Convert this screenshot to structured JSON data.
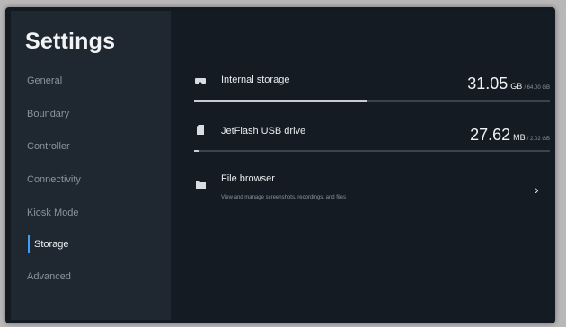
{
  "sidebar": {
    "title": "Settings",
    "items": [
      {
        "label": "General"
      },
      {
        "label": "Boundary"
      },
      {
        "label": "Controller"
      },
      {
        "label": "Connectivity"
      },
      {
        "label": "Kiosk Mode"
      },
      {
        "label": "Storage"
      },
      {
        "label": "Advanced"
      }
    ],
    "active_item": "Storage"
  },
  "storage": {
    "internal": {
      "label": "Internal storage",
      "used_value": "31.05",
      "used_unit": "GB",
      "total": "/ 64.00 GB",
      "used_fraction": 0.485
    },
    "usb": {
      "label": "JetFlash USB drive",
      "used_value": "27.62",
      "used_unit": "MB",
      "total": "/ 2.02 GB",
      "used_fraction": 0.013
    },
    "file_browser": {
      "label": "File browser",
      "description": "View and manage screenshots, recordings, and files"
    }
  },
  "colors": {
    "accent": "#3aa0ff",
    "sidebar_bg": "#1f2831",
    "main_bg": "#141b23"
  }
}
